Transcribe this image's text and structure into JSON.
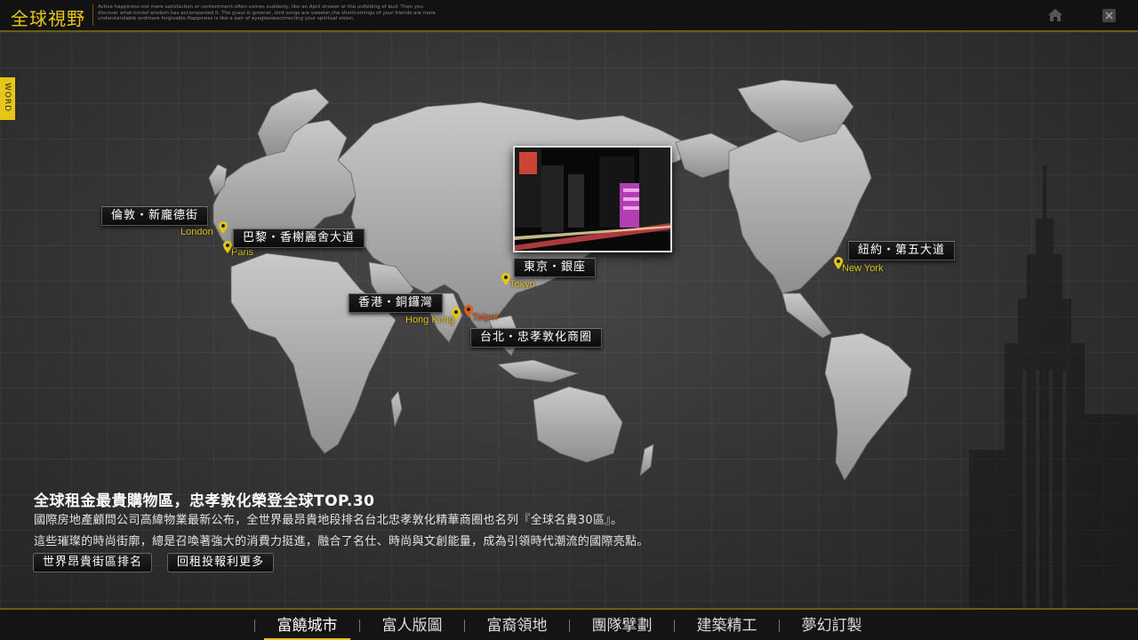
{
  "header": {
    "title": "全球視野",
    "tagline": "Active happiness-not mere satisfaction or contentment-often comes suddenly, like an April shower or the unfolding of bud. Then you discover what kindof wisdom has accompanied it. The grass is greener, bird songs are sweeter,the shortcomings of your friends are more understandable andmore forgivable.Happiness is like a pair of eyeglassescorrecting your spiritual vision.",
    "home_icon": "home-icon",
    "close_icon": "close-icon",
    "accent_color": "#e6c619"
  },
  "side_tab": {
    "label": "WORD"
  },
  "map": {
    "locations": [
      {
        "label": "倫敦・新龐德街",
        "city": "London"
      },
      {
        "label": "巴黎・香榭麗舍大道",
        "city": "Paris"
      },
      {
        "label": "東京・銀座",
        "city": "Tokyo"
      },
      {
        "label": "香港・銅鑼灣",
        "city": "Hong Kong"
      },
      {
        "label": "台北・忠孝敦化商圈",
        "city": "Taipei"
      },
      {
        "label": "紐約・第五大道",
        "city": "New York"
      }
    ],
    "highlight_color": "#e05a1a"
  },
  "content": {
    "headline": "全球租金最貴購物區，忠孝敦化榮登全球TOP.30",
    "line1": "國際房地產顧問公司高緯物業最新公布，全世界最昂貴地段排名台北忠孝敦化精華商圈也名列『全球名貴30區』。",
    "line2": "這些璀璨的時尚街廓，總是召喚著強大的消費力挺進，融合了名仕、時尚與文創能量，成為引領時代潮流的國際亮點。",
    "buttons": [
      "世界昂貴街區排名",
      "回租投報利更多"
    ]
  },
  "nav": {
    "items": [
      "富饒城市",
      "富人版圖",
      "富裔領地",
      "團隊擘劃",
      "建築精工",
      "夢幻訂製"
    ],
    "active": "富饒城市"
  }
}
